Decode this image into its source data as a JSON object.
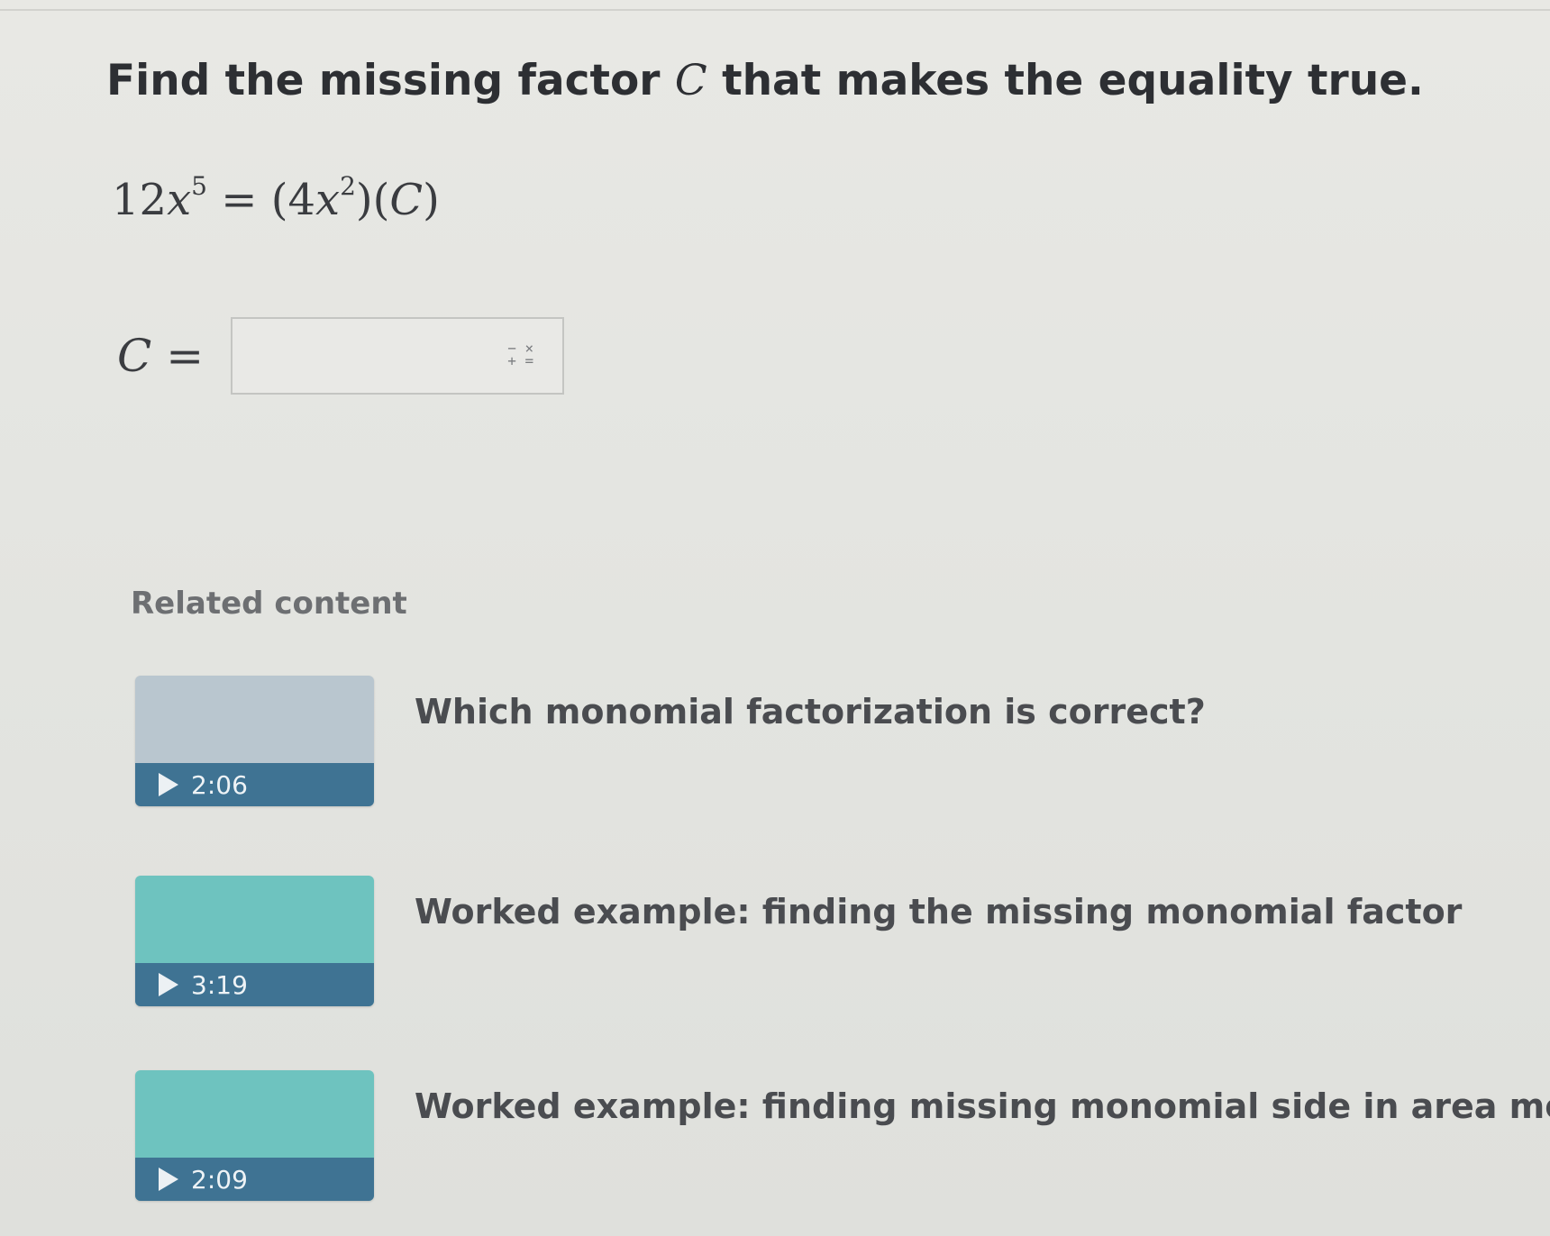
{
  "question": {
    "title_before": "Find the missing factor ",
    "title_var": "C",
    "title_after": " that makes the equality true.",
    "equation": {
      "lhs_coef": "12",
      "lhs_var": "x",
      "lhs_exp": "5",
      "eq": "=",
      "paren_open": "(4",
      "rhs_var": "x",
      "rhs_exp": "2",
      "paren_close": ")(",
      "rhs_C": "C",
      "close": ")"
    },
    "answer_label": "C",
    "answer_eq": "=",
    "answer_value": "",
    "math_keypad_icon_top": "− ×",
    "math_keypad_icon_bottom": "+ ="
  },
  "related": {
    "heading": "Related content",
    "items": [
      {
        "title": "Which monomial factorization is correct?",
        "duration": "2:06",
        "thumb_color": "#b9c6cf",
        "icon": "play-icon"
      },
      {
        "title": "Worked example: finding the missing monomial factor",
        "duration": "3:19",
        "thumb_color": "#6ec3bf",
        "icon": "play-icon"
      },
      {
        "title": "Worked example: finding missing monomial side in area model",
        "duration": "2:09",
        "thumb_color": "#6ec3bf",
        "icon": "play-icon"
      }
    ]
  },
  "colors": {
    "background": "#e3e4e0",
    "video_bar": "#3f7393"
  }
}
